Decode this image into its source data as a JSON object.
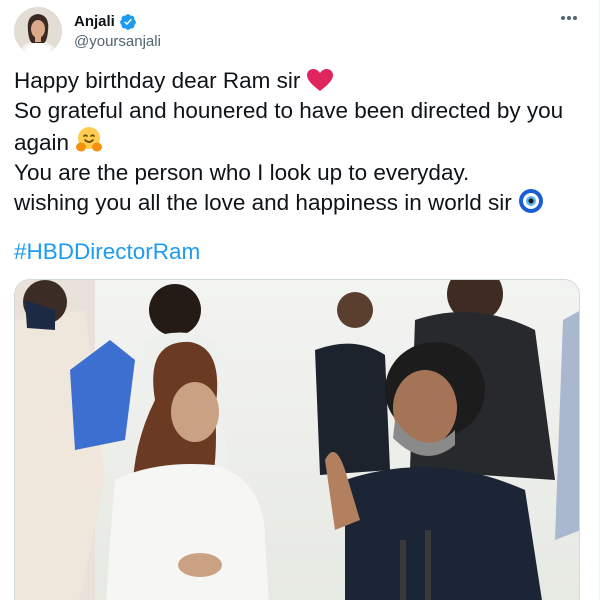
{
  "tweet": {
    "author": {
      "display_name": "Anjali",
      "handle": "@yoursanjali",
      "verified": true
    },
    "lines": [
      "Happy birthday dear Ram sir",
      "So grateful and hounered to have been directed by you",
      "again",
      "You are the person who I look up to everyday.",
      "wishing you all the love and happiness in world sir"
    ],
    "hashtag": "#HBDDirectorRam",
    "emojis": [
      "red-heart",
      "hugging-face",
      "nazar-amulet"
    ]
  },
  "colors": {
    "link": "#1d9bf0",
    "verified": "#1d9bf0",
    "secondary_text": "#536471",
    "heart": "#e0245e"
  }
}
